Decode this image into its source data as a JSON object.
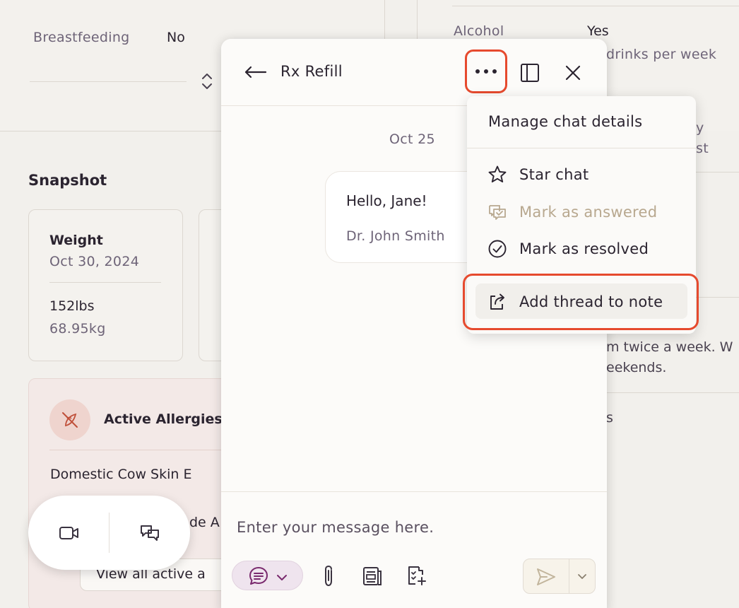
{
  "background": {
    "breastfeeding_label": "Breastfeeding",
    "breastfeeding_value": "No",
    "alcohol_label": "Alcohol",
    "alcohol_value": "Yes",
    "alcohol_detail": "drinks per week",
    "partial_text_1": "y",
    "partial_text_2": "st",
    "partial_text_3": "m twice a week. W",
    "partial_text_4": "eekends.",
    "partial_text_5": "s",
    "snapshot_title": "Snapshot",
    "weight_label": "Weight",
    "weight_date": "Oct 30, 2024",
    "weight_lbs": "152lbs",
    "weight_kg": "68.95kg",
    "allergies_title": "Active Allergies",
    "allergy_1": "Domestic Cow Skin E",
    "allergy_2": "de A",
    "view_all_label": "View all active a"
  },
  "chat": {
    "title": "Rx Refill",
    "date_divider": "Oct 25",
    "message_text": "Hello, Jane!",
    "message_author": "Dr. John Smith",
    "input_placeholder": "Enter your message here."
  },
  "menu": {
    "items": [
      {
        "label": "Manage chat details",
        "icon": "none",
        "disabled": false
      },
      {
        "label": "Star chat",
        "icon": "star-icon",
        "disabled": false
      },
      {
        "label": "Mark as answered",
        "icon": "chat-check-icon",
        "disabled": true
      },
      {
        "label": "Mark as resolved",
        "icon": "circle-check-icon",
        "disabled": false
      },
      {
        "label": "Add thread to note",
        "icon": "share-icon",
        "disabled": false
      }
    ]
  },
  "colors": {
    "highlight": "#e64a2e",
    "template_accent": "#7a2a6e",
    "disabled_text": "#b8a88f"
  }
}
